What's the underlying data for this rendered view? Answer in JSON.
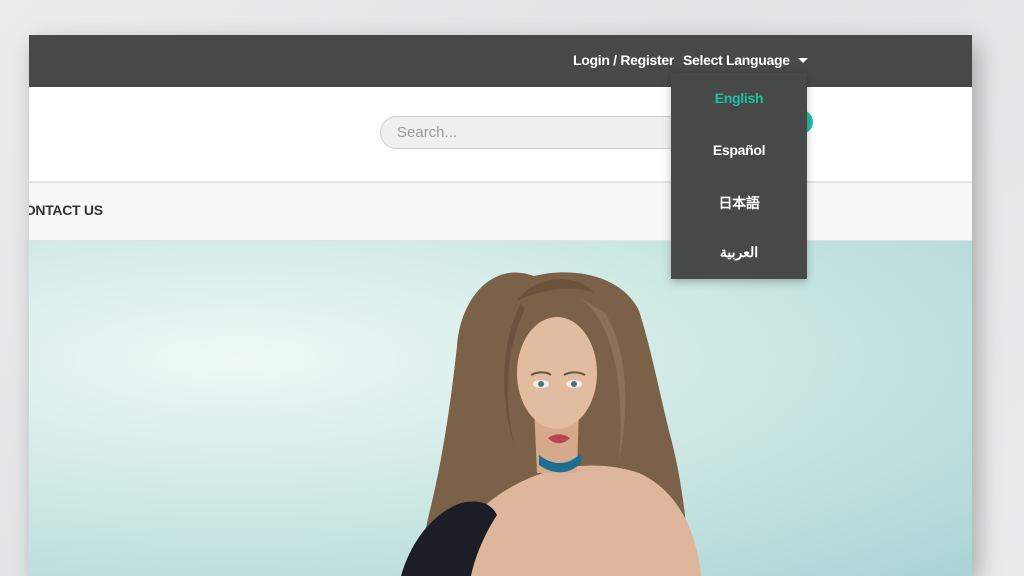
{
  "topbar": {
    "login_label": "Login / Register",
    "language_label": "Select Language",
    "caret_icon": "caret-down-icon"
  },
  "search": {
    "placeholder": "Search..."
  },
  "nav": {
    "items": [
      {
        "label": "CONTACT US"
      }
    ]
  },
  "language_menu": {
    "selected": "English",
    "options": [
      {
        "label": "English"
      },
      {
        "label": "Español"
      },
      {
        "label": "日本語"
      },
      {
        "label": "العربية"
      }
    ]
  },
  "hero": {
    "image": "woman-portrait"
  },
  "colors": {
    "topbar_bg": "#474948",
    "accent": "#1fc0a4",
    "nav_bg": "#f8f8f6",
    "hero_bg": "#bfe0de"
  }
}
